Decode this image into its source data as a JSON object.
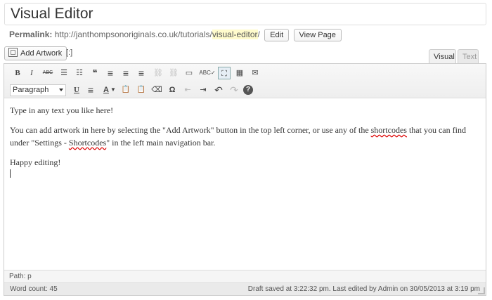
{
  "post_title": "Visual Editor",
  "permalink": {
    "label": "Permalink:",
    "base_url": "http://janthompsonoriginals.co.uk/tutorials/",
    "slug": "visual-editor",
    "trailing": "/",
    "edit_label": "Edit",
    "view_label": "View Page"
  },
  "media": {
    "add_artwork_label": "Add Artwork",
    "extra_label": "[:]"
  },
  "tabs": {
    "visual": "Visual",
    "text": "Text"
  },
  "toolbar": {
    "row1": [
      {
        "name": "bold-icon",
        "glyph": "B"
      },
      {
        "name": "italic-icon",
        "glyph": "I"
      },
      {
        "name": "strikethrough-icon",
        "glyph": "ABC"
      },
      {
        "name": "bullet-list-icon",
        "glyph": "☰"
      },
      {
        "name": "numbered-list-icon",
        "glyph": "☷"
      },
      {
        "name": "blockquote-icon",
        "glyph": "❝"
      },
      {
        "name": "align-left-icon",
        "glyph": "≡"
      },
      {
        "name": "align-center-icon",
        "glyph": "≡"
      },
      {
        "name": "align-right-icon",
        "glyph": "≡"
      },
      {
        "name": "link-icon",
        "glyph": "⛓"
      },
      {
        "name": "unlink-icon",
        "glyph": "⛓"
      },
      {
        "name": "more-tag-icon",
        "glyph": "▭"
      },
      {
        "name": "spellcheck-icon",
        "glyph": "ABC✓"
      },
      {
        "name": "fullscreen-icon",
        "glyph": "⛶"
      },
      {
        "name": "kitchen-sink-icon",
        "glyph": "▦"
      },
      {
        "name": "email-icon",
        "glyph": "✉"
      }
    ],
    "format_select": "Paragraph",
    "row2": [
      {
        "name": "underline-icon",
        "glyph": "U"
      },
      {
        "name": "justify-icon",
        "glyph": "≡"
      },
      {
        "name": "text-color-icon",
        "glyph": "A"
      },
      {
        "name": "paste-text-icon",
        "glyph": "📋"
      },
      {
        "name": "paste-word-icon",
        "glyph": "📋"
      },
      {
        "name": "clear-formatting-icon",
        "glyph": "⌫"
      },
      {
        "name": "special-character-icon",
        "glyph": "Ω"
      },
      {
        "name": "outdent-icon",
        "glyph": "⇤"
      },
      {
        "name": "indent-icon",
        "glyph": "⇥"
      },
      {
        "name": "undo-icon",
        "glyph": "↶"
      },
      {
        "name": "redo-icon",
        "glyph": "↷"
      },
      {
        "name": "help-icon",
        "glyph": "?"
      }
    ]
  },
  "content": {
    "p1": "Type in any text you like here!",
    "p2_a": "You can add artwork in here by selecting the \"Add Artwork\" button in the top left corner, or use any of the ",
    "p2_link": "shortcodes",
    "p2_b": " that you can find under \"Settings - ",
    "p2_link2": "Shortcodes",
    "p2_c": "\" in the left main navigation bar.",
    "p3": "Happy editing!"
  },
  "path_bar": "Path: p",
  "status": {
    "word_count": "Word count: 45",
    "draft_info": "Draft saved at 3:22:32 pm. Last edited by Admin on 30/05/2013 at 3:19 pm"
  }
}
